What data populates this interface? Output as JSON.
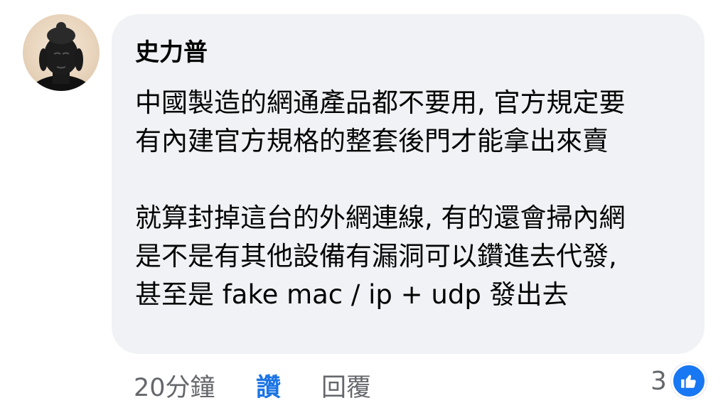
{
  "comment": {
    "author": "史力普",
    "lines": [
      "中國製造的網通產品都不要用, 官方規定要",
      "有內建官方規格的整套後門才能拿出來賣",
      "",
      "就算封掉這台的外網連線, 有的還會掃內網",
      "是不是有其他設備有漏洞可以鑽進去代發,",
      "甚至是 fake mac / ip + udp 發出去"
    ],
    "timestamp": "20分鐘",
    "like_label": "讚",
    "reply_label": "回覆",
    "reaction_count": "3",
    "reaction_icon": "thumbs-up-icon",
    "colors": {
      "bubble": "#f0f2f5",
      "like_active": "#1b74e4",
      "meta_text": "#65676b",
      "reaction_blue": "#1877f2"
    }
  }
}
